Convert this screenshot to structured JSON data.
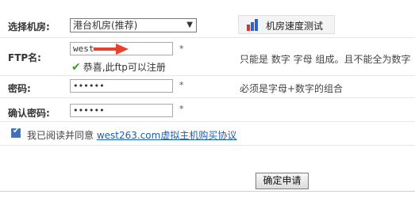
{
  "room": {
    "label": "选择机房:",
    "selected": "港台机房(推荐)",
    "speed_test": "机房速度测试"
  },
  "ftp": {
    "label": "FTP名:",
    "value": "west",
    "star": "*",
    "success": "恭喜,此ftp可以注册",
    "hint": "只能是 数字 字母 组成。且不能全为数字"
  },
  "password": {
    "label": "密码:",
    "value": "••••••",
    "star": "*",
    "hint": "必须是字母+数字的组合"
  },
  "confirm": {
    "label": "确认密码:",
    "value": "••••••",
    "star": "*"
  },
  "agreement": {
    "prefix": "我已阅读并同意 ",
    "link": "west263.com虚拟主机购买协议",
    "checked": true
  },
  "submit": {
    "label": "确定申请"
  },
  "colors": {
    "accent": "#1b5fb3",
    "success": "#3a9d23",
    "arrow": "#e8412e"
  }
}
